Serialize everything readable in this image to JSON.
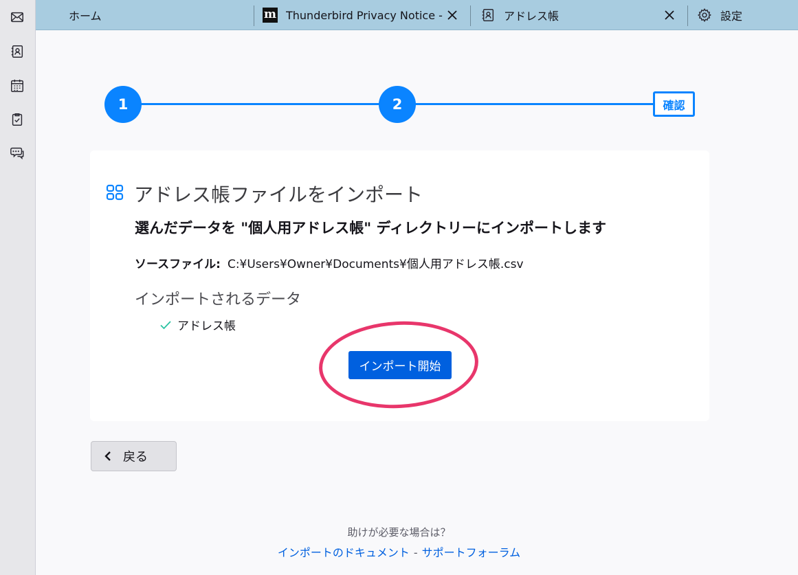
{
  "tabs": [
    {
      "label": "ホーム"
    },
    {
      "label": "Thunderbird Privacy Notice -"
    },
    {
      "label": "アドレス帳"
    },
    {
      "label": "設定"
    }
  ],
  "tab_icons": {
    "privacy_logo": "m"
  },
  "stepper": {
    "step1": "1",
    "step2": "2",
    "step3": "確認"
  },
  "card": {
    "title": "アドレス帳ファイルをインポート",
    "heading": "選んだデータを \"個人用アドレス帳\" ディレクトリーにインポートします",
    "source_label": "ソースファイル:",
    "source_path": "C:¥Users¥Owner¥Documents¥個人用アドレス帳.csv",
    "data_label": "インポートされるデータ",
    "data_items": [
      "アドレス帳"
    ],
    "start_button": "インポート開始"
  },
  "back_button": "戻る",
  "help": {
    "question": "助けが必要な場合は？",
    "docs_link": "インポートのドキュメント",
    "separator": "-",
    "forum_link": "サポートフォーラム"
  },
  "colors": {
    "accent": "#0a84ff",
    "button": "#0060df",
    "highlight": "#e8366b",
    "tabbar": "#a8cce0"
  }
}
